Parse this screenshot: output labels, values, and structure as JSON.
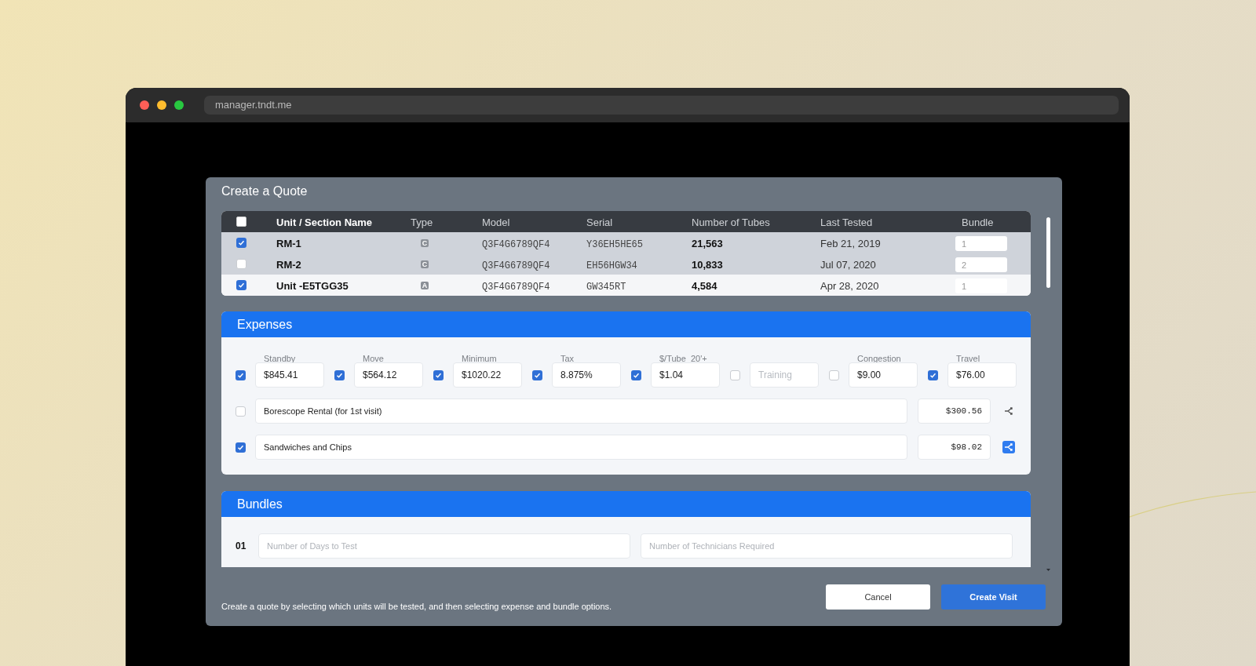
{
  "browser": {
    "address": "manager.tndt.me"
  },
  "dialog": {
    "title": "Create a Quote",
    "units": {
      "select_all": {
        "checked": false
      },
      "columns": [
        "Unit / Section Name",
        "Type",
        "Model",
        "Serial",
        "Number of Tubes",
        "Last Tested",
        "Bundle"
      ],
      "rows": [
        {
          "checked": true,
          "selected": true,
          "name": "RM-1",
          "type": "C",
          "model": "Q3F4G6789QF4",
          "serial": "Y36EH5HE65",
          "tubes": "21,563",
          "last_tested": "Feb 21, 2019",
          "bundle": "1"
        },
        {
          "checked": false,
          "selected": true,
          "name": "RM-2",
          "type": "C",
          "model": "Q3F4G6789QF4",
          "serial": "EH56HGW34",
          "tubes": "10,833",
          "last_tested": "Jul 07, 2020",
          "bundle": "2"
        },
        {
          "checked": true,
          "selected": false,
          "name": "Unit -E5TGG35",
          "type": "A",
          "model": "Q3F4G6789QF4",
          "serial": "GW345RT",
          "tubes": "4,584",
          "last_tested": "Apr 28, 2020",
          "bundle": "1"
        }
      ]
    },
    "expenses": {
      "title": "Expenses",
      "fields": [
        {
          "label": "Standby",
          "checked": true,
          "value": "$845.41"
        },
        {
          "label": "Move",
          "checked": true,
          "value": "$564.12"
        },
        {
          "label": "Minimum",
          "checked": true,
          "value": "$1020.22"
        },
        {
          "label": "Tax",
          "checked": true,
          "value": "8.875%"
        },
        {
          "label": "$/Tube  20'+",
          "checked": true,
          "value": "$1.04"
        },
        {
          "checked": false,
          "placeholder": "Training"
        },
        {
          "label": "Congestion",
          "checked": false,
          "value": "$9.00"
        },
        {
          "label": "Travel",
          "checked": true,
          "value": "$76.00"
        }
      ],
      "line_items": [
        {
          "checked": false,
          "description": "Borescope Rental (for 1st visit)",
          "amount": "$300.56",
          "linked": false
        },
        {
          "checked": true,
          "description": "Sandwiches and Chips",
          "amount": "$98.02",
          "linked": true
        }
      ]
    },
    "bundles": {
      "title": "Bundles",
      "rows": [
        {
          "number": "01",
          "days_placeholder": "Number of Days to Test",
          "technicians_placeholder": "Number of Technicians Required"
        }
      ]
    },
    "footer": {
      "note": "Create a quote by selecting which units will be tested, and then selecting expense and bundle options.",
      "buttons": [
        {
          "label": "Cancel",
          "kind": "secondary"
        },
        {
          "label": "Create Visit",
          "kind": "primary"
        }
      ]
    }
  }
}
